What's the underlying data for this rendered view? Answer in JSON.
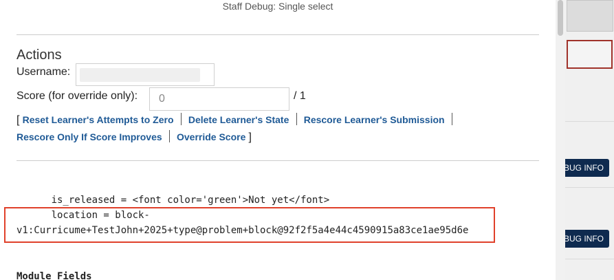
{
  "modal": {
    "title": "Staff Debug: Single select"
  },
  "actions": {
    "heading": "Actions",
    "username_label": "Username:",
    "score_label": "Score (for override only):",
    "score_placeholder": "0",
    "score_total": "/ 1",
    "open_bracket": "[",
    "close_bracket": "]",
    "links": [
      "Reset Learner's Attempts to Zero",
      "Delete Learner's State",
      "Rescore Learner's Submission",
      "Rescore Only If Score Improves",
      "Override Score"
    ]
  },
  "debug": {
    "line1": "      is_released = <font color='green'>Not yet</font>",
    "line2": "      location = block-",
    "line3": "v1:Curricume+TestJohn+2025+type@problem+block@92f2f5a4e44c4590915a83ce1ae95d6e",
    "module_fields": "Module Fields"
  },
  "right_panel": {
    "debug_button_1": "BUG INFO",
    "debug_button_2": "BUG INFO"
  },
  "colors": {
    "link": "#1f5a96",
    "highlight_border": "#e0402a",
    "debug_button_bg": "#0e2a4f"
  }
}
